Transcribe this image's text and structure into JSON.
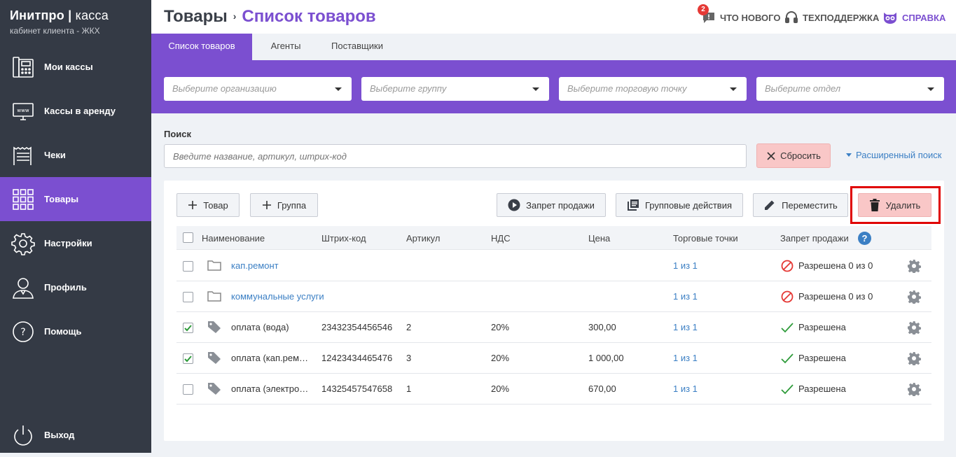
{
  "brand": {
    "name_bold": "Инитпро",
    "divider": "|",
    "name_light": "касса",
    "subtitle": "кабинет клиента - ЖКХ"
  },
  "sidebar": {
    "items": [
      {
        "label": "Мои кассы",
        "icon": "cash-register-icon"
      },
      {
        "label": "Кассы в аренду",
        "icon": "www-monitor-icon"
      },
      {
        "label": "Чеки",
        "icon": "receipt-icon"
      },
      {
        "label": "Товары",
        "icon": "grid-icon",
        "active": true
      },
      {
        "label": "Настройки",
        "icon": "gear-icon"
      },
      {
        "label": "Профиль",
        "icon": "user-icon"
      },
      {
        "label": "Помощь",
        "icon": "question-icon"
      }
    ],
    "logout": {
      "label": "Выход",
      "icon": "power-icon"
    }
  },
  "header": {
    "crumb_root": "Товары",
    "crumb_sep": "›",
    "crumb_current": "Список товаров",
    "whats_new": {
      "label": "ЧТО НОВОГО",
      "badge": "2"
    },
    "support": {
      "label": "ТЕХПОДДЕРЖКА"
    },
    "help": {
      "label": "СПРАВКА"
    }
  },
  "tabs": [
    {
      "label": "Список товаров",
      "active": true
    },
    {
      "label": "Агенты"
    },
    {
      "label": "Поставщики"
    }
  ],
  "filters": {
    "organization": "Выберите организацию",
    "group": "Выберите группу",
    "point": "Выберите торговую точку",
    "department": "Выберите отдел"
  },
  "search": {
    "label": "Поиск",
    "placeholder": "Введите название, артикул, штрих-код",
    "reset_label": "Сбросить",
    "advanced_label": "Расширенный поиск"
  },
  "toolbar": {
    "add_item": "Товар",
    "add_group": "Группа",
    "ban_sale": "Запрет продажи",
    "group_actions": "Групповые действия",
    "move": "Переместить",
    "delete": "Удалить"
  },
  "table": {
    "headers": {
      "name": "Наименование",
      "barcode": "Штрих-код",
      "article": "Артикул",
      "vat": "НДС",
      "price": "Цена",
      "points": "Торговые точки",
      "ban": "Запрет продажи",
      "ban_help": "?"
    },
    "rows": [
      {
        "type": "folder",
        "name": "кап.ремонт",
        "barcode": "",
        "article": "",
        "vat": "",
        "price": "",
        "points": "1 из 1",
        "ban_status": "Разрешена 0 из 0",
        "ban_icon": "forbidden-icon",
        "checked": false
      },
      {
        "type": "folder",
        "name": "коммунальные услуги",
        "barcode": "",
        "article": "",
        "vat": "",
        "price": "",
        "points": "1 из 1",
        "ban_status": "Разрешена 0 из 0",
        "ban_icon": "forbidden-icon",
        "checked": false
      },
      {
        "type": "item",
        "name": "оплата (вода)",
        "barcode": "23432354456546",
        "article": "2",
        "vat": "20%",
        "price": "300,00",
        "points": "1 из 1",
        "ban_status": "Разрешена",
        "ban_icon": "check-icon",
        "checked": true
      },
      {
        "type": "item",
        "name": "оплата (кап.рем…",
        "barcode": "12423434465476",
        "article": "3",
        "vat": "20%",
        "price": "1 000,00",
        "points": "1 из 1",
        "ban_status": "Разрешена",
        "ban_icon": "check-icon",
        "checked": true
      },
      {
        "type": "item",
        "name": "оплата (электро…",
        "barcode": "14325457547658",
        "article": "1",
        "vat": "20%",
        "price": "670,00",
        "points": "1 из 1",
        "ban_status": "Разрешена",
        "ban_icon": "check-icon",
        "checked": false
      }
    ]
  },
  "colors": {
    "accent": "#7b4fd0",
    "sidebar": "#343a45",
    "link": "#3b7fc4",
    "danger_bg": "#f9c7c7",
    "highlight": "#e00000"
  }
}
